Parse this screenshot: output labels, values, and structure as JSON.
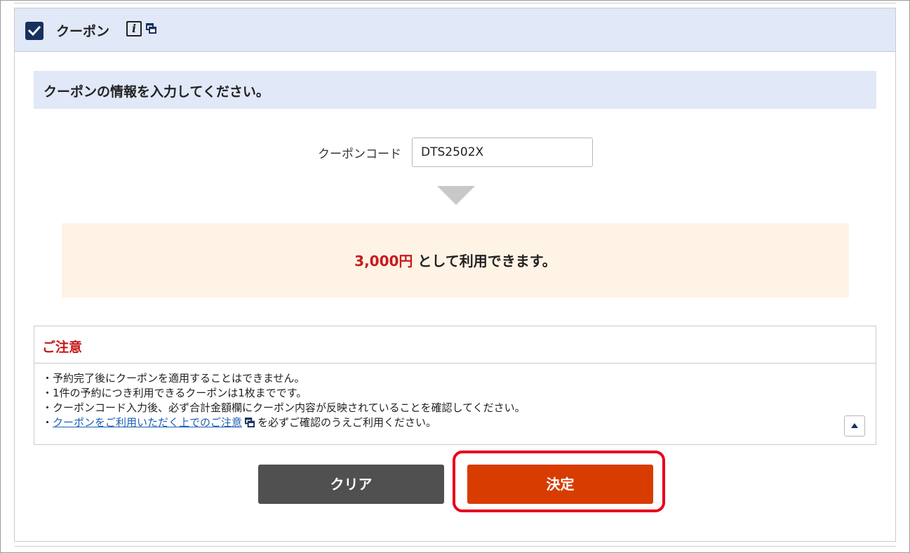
{
  "header": {
    "title": "クーポン",
    "info_glyph": "i"
  },
  "section": {
    "title": "クーポンの情報を入力してください。"
  },
  "coupon_form": {
    "label": "クーポンコード",
    "value": "DTS2502X"
  },
  "result": {
    "amount": "3,000円",
    "suffix": " として利用できます。"
  },
  "notice": {
    "title": "ご注意",
    "items": [
      "・予約完了後にクーポンを適用することはできません。",
      "・1件の予約につき利用できるクーポンは1枚までです。",
      "・クーポンコード入力後、必ず合計金額欄にクーポン内容が反映されていることを確認してください。"
    ],
    "last_item": {
      "prefix": "・",
      "link": "クーポンをご利用いただく上でのご注意",
      "suffix": "を必ずご確認のうえご利用ください。"
    }
  },
  "buttons": {
    "clear": "クリア",
    "decide": "決定"
  },
  "colors": {
    "header_bg": "#e1e8f7",
    "checkbox": "#17305e",
    "result_bg": "#fff3e6",
    "accent_red": "#c81a1a",
    "clear_button": "#505050",
    "decide_button": "#d83c00",
    "highlight": "#e8001c",
    "link": "#1a5fb4"
  },
  "icons": {
    "checkbox": "checkmark-icon",
    "info": "info-icon",
    "new_window": "new-window-icon",
    "scroll_top": "caret-up-icon"
  }
}
